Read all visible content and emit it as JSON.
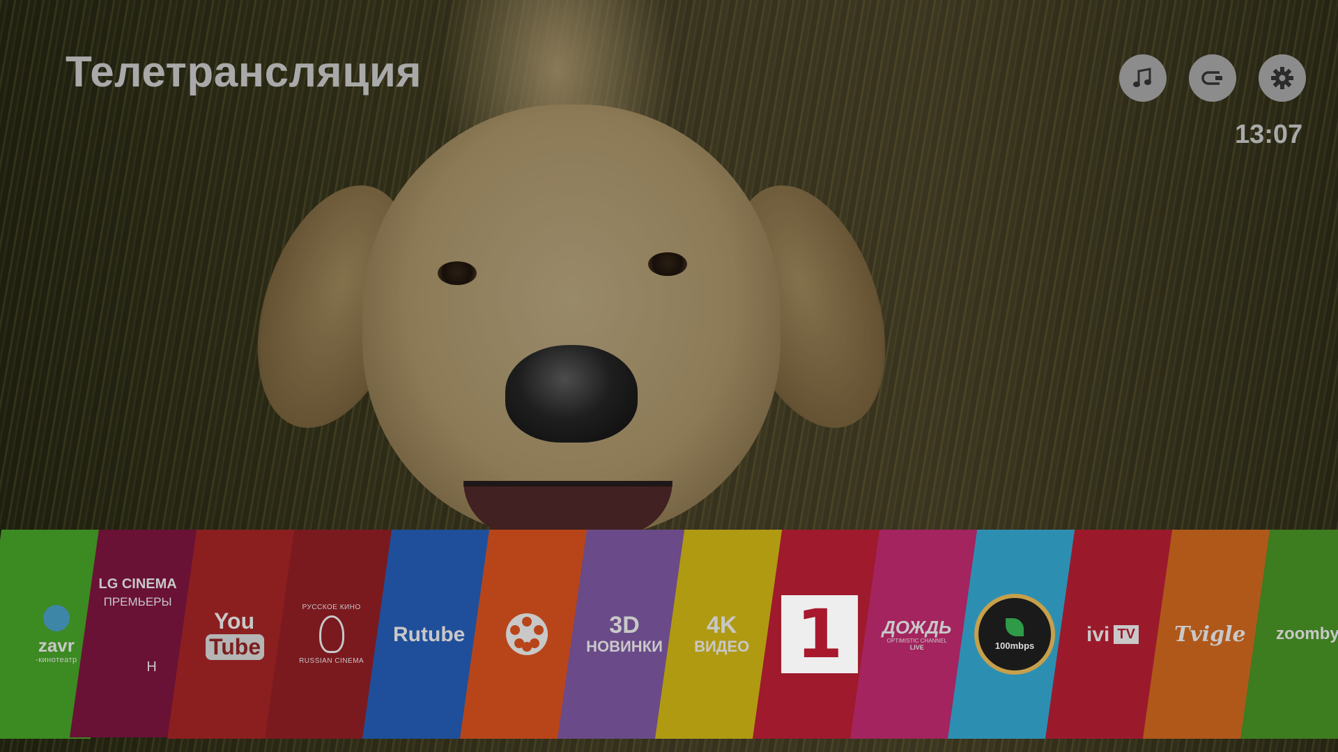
{
  "header": {
    "title": "Телетрансляция",
    "clock": "13:07",
    "icons": [
      {
        "name": "music-icon"
      },
      {
        "name": "input-icon"
      },
      {
        "name": "settings-icon"
      }
    ]
  },
  "launcher": {
    "tiles": [
      {
        "id": "zavr",
        "line1": "zavr",
        "line2": "-кинотеатр",
        "color": "#3c8a22"
      },
      {
        "id": "lg-cinema",
        "line1": "LG CINEMA",
        "line2": "ПРЕМЬЕРЫ",
        "line3": "Н",
        "color": "#6a1136"
      },
      {
        "id": "youtube",
        "line1": "You",
        "line2": "Tube",
        "color": "#8b1f1f"
      },
      {
        "id": "russian-cinema",
        "line1": "РУССКОЕ КИНО",
        "line2": "RUSSIAN CINEMA",
        "color": "#7a1a1f"
      },
      {
        "id": "rutube",
        "line1": "Rutube",
        "color": "#1f4f9a"
      },
      {
        "id": "film-reel",
        "color": "#b8451a"
      },
      {
        "id": "3d",
        "line1": "3D",
        "line2": "НОВИНКИ",
        "color": "#6a4a88"
      },
      {
        "id": "4k",
        "line1": "4K",
        "line2": "ВИДЕО",
        "color": "#b09a12"
      },
      {
        "id": "channel-one",
        "line1": "1",
        "color": "#9e1a2c"
      },
      {
        "id": "dozhd",
        "line1": "ДОЖДЬ",
        "line2": "OPTIMISTIC CHANNEL",
        "line3": "LIVE",
        "color": "#a3245e"
      },
      {
        "id": "speedtest",
        "line1": "100mbps",
        "color": "#2c8fb2"
      },
      {
        "id": "ivi",
        "line1": "ivi",
        "line2": "TV",
        "color": "#9a1a2c"
      },
      {
        "id": "tvigle",
        "line1": "Tvigle",
        "color": "#b0581a"
      },
      {
        "id": "zoomby",
        "line1": "zoomby",
        "color": "#3d7c1f"
      }
    ]
  }
}
